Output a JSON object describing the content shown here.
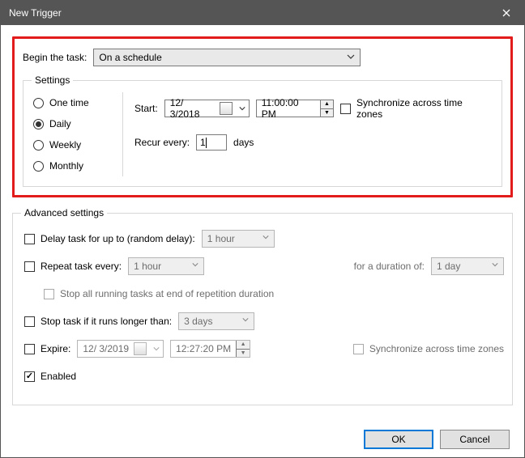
{
  "window": {
    "title": "New Trigger"
  },
  "begin": {
    "label": "Begin the task:",
    "value": "On a schedule"
  },
  "settings": {
    "legend": "Settings",
    "periods": [
      {
        "label": "One time",
        "checked": false
      },
      {
        "label": "Daily",
        "checked": true
      },
      {
        "label": "Weekly",
        "checked": false
      },
      {
        "label": "Monthly",
        "checked": false
      }
    ],
    "start_label": "Start:",
    "start_date": "12/  3/2018",
    "start_time": "11:00:00 PM",
    "sync_label": "Synchronize across time zones",
    "sync_checked": false,
    "recur_label": "Recur every:",
    "recur_value": "1",
    "recur_unit": "days"
  },
  "advanced": {
    "legend": "Advanced settings",
    "delay": {
      "label": "Delay task for up to (random delay):",
      "value": "1 hour",
      "checked": false
    },
    "repeat": {
      "label": "Repeat task every:",
      "value": "1 hour",
      "checked": false,
      "duration_label": "for a duration of:",
      "duration_value": "1 day"
    },
    "stop_repeat": {
      "label": "Stop all running tasks at end of repetition duration",
      "checked": false
    },
    "stop_long": {
      "label": "Stop task if it runs longer than:",
      "value": "3 days",
      "checked": false
    },
    "expire": {
      "label": "Expire:",
      "date": "12/  3/2019",
      "time": "12:27:20 PM",
      "checked": false,
      "sync_label": "Synchronize across time zones",
      "sync_checked": false
    },
    "enabled": {
      "label": "Enabled",
      "checked": true
    }
  },
  "buttons": {
    "ok": "OK",
    "cancel": "Cancel"
  }
}
